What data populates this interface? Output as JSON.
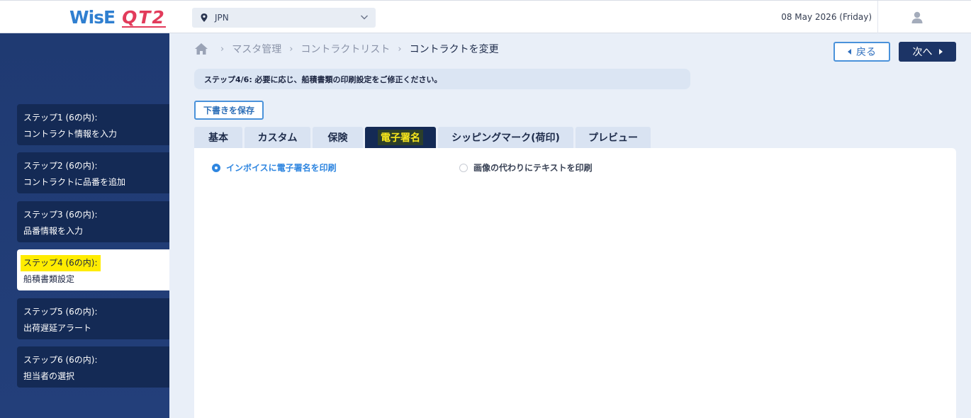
{
  "header": {
    "logo_left": "WisE",
    "logo_right": "QT2",
    "country": "JPN",
    "date": "08 May 2026 (Friday)"
  },
  "sidebar": {
    "steps": [
      {
        "title": "ステップ1 (6の内):",
        "label": "コントラクト情報を入力",
        "active": false
      },
      {
        "title": "ステップ2 (6の内):",
        "label": "コントラクトに品番を追加",
        "active": false
      },
      {
        "title": "ステップ3 (6の内):",
        "label": "品番情報を入力",
        "active": false
      },
      {
        "title": "ステップ4 (6の内):",
        "label": "船積書類設定",
        "active": true
      },
      {
        "title": "ステップ5 (6の内):",
        "label": "出荷遅延アラート",
        "active": false
      },
      {
        "title": "ステップ6 (6の内):",
        "label": "担当者の選択",
        "active": false
      }
    ]
  },
  "breadcrumb": {
    "items": [
      "マスタ管理",
      "コントラクトリスト"
    ],
    "current": "コントラクトを変更"
  },
  "actions": {
    "back_label": "戻る",
    "next_label": "次へ",
    "draft_label": "下書きを保存"
  },
  "notice": "ステップ4/6: 必要に応じ、船積書類の印刷設定をご修正ください。",
  "tabs": [
    {
      "label": "基本",
      "active": false
    },
    {
      "label": "カスタム",
      "active": false
    },
    {
      "label": "保険",
      "active": false
    },
    {
      "label": "電子署名",
      "active": true
    },
    {
      "label": "シッピングマーク(荷印)",
      "active": false
    },
    {
      "label": "プレビュー",
      "active": false
    }
  ],
  "signature_options": [
    {
      "label": "インボイスに電子署名を印刷",
      "selected": true
    },
    {
      "label": "画像の代わりにテキストを印刷",
      "selected": false
    }
  ],
  "colors": {
    "sidebar": "#1f3a72",
    "accent": "#2f86e0",
    "highlight": "#ffec00",
    "brand_red": "#e23b5b"
  }
}
